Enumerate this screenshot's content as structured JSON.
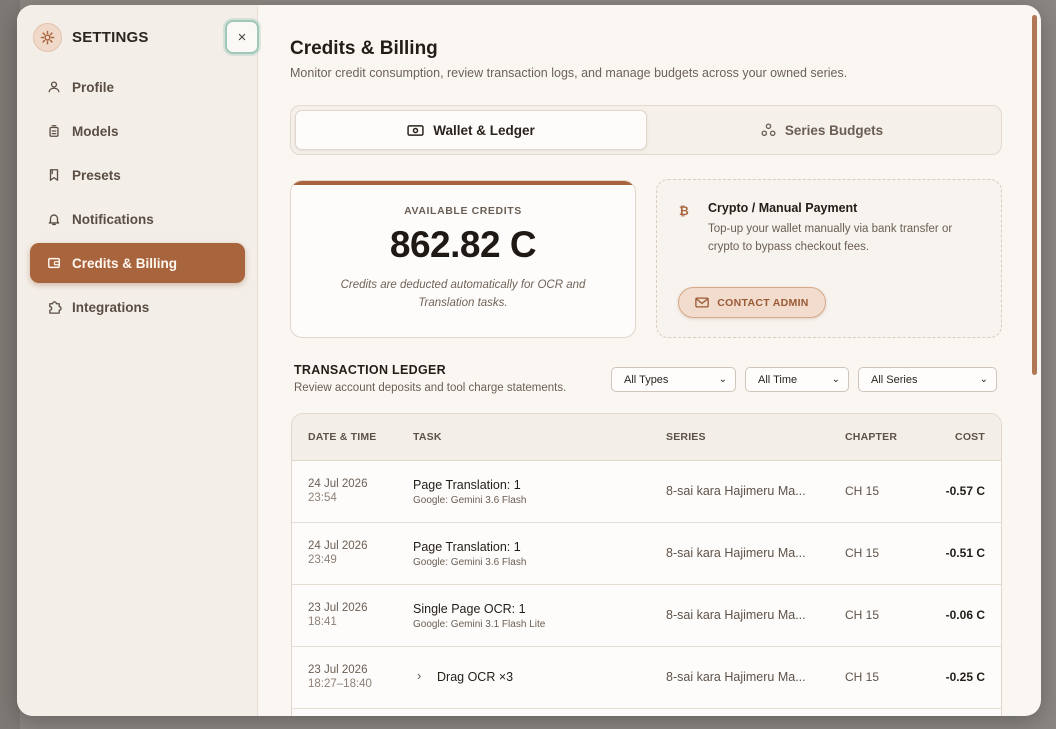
{
  "sidebar": {
    "title": "SETTINGS",
    "close_label": "×",
    "items": [
      {
        "label": "Profile",
        "icon": "user-icon"
      },
      {
        "label": "Models",
        "icon": "model-icon"
      },
      {
        "label": "Presets",
        "icon": "bookmark-icon"
      },
      {
        "label": "Notifications",
        "icon": "bell-icon"
      },
      {
        "label": "Credits & Billing",
        "icon": "wallet-icon",
        "active": true
      },
      {
        "label": "Integrations",
        "icon": "puzzle-icon"
      }
    ]
  },
  "main": {
    "title": "Credits & Billing",
    "subtitle": "Monitor credit consumption, review transaction logs, and manage budgets across your owned series.",
    "tabs": [
      {
        "label": "Wallet & Ledger",
        "active": true
      },
      {
        "label": "Series Budgets",
        "active": false
      }
    ],
    "credits": {
      "label": "AVAILABLE CREDITS",
      "value": "862.82 C",
      "note": "Credits are deducted automatically for OCR and Translation tasks."
    },
    "crypto": {
      "symbol": "₿",
      "title": "Crypto / Manual Payment",
      "description": "Top-up your wallet manually via bank transfer or crypto to bypass checkout fees.",
      "button": "CONTACT ADMIN"
    },
    "ledger": {
      "title": "TRANSACTION LEDGER",
      "subtitle": "Review account deposits and tool charge statements.",
      "filters": [
        "All Types",
        "All Time",
        "All Series"
      ],
      "columns": [
        "DATE & TIME",
        "TASK",
        "SERIES",
        "CHAPTER",
        "COST"
      ],
      "rows": [
        {
          "date": "24 Jul 2026",
          "time": "23:54",
          "task": "Page Translation: 1",
          "model": "Google: Gemini 3.6 Flash",
          "series": "8-sai kara Hajimeru Ma...",
          "chapter": "CH 15",
          "cost": "-0.57 C"
        },
        {
          "date": "24 Jul 2026",
          "time": "23:49",
          "task": "Page Translation: 1",
          "model": "Google: Gemini 3.6 Flash",
          "series": "8-sai kara Hajimeru Ma...",
          "chapter": "CH 15",
          "cost": "-0.51 C"
        },
        {
          "date": "23 Jul 2026",
          "time": "18:41",
          "task": "Single Page OCR: 1",
          "model": "Google: Gemini 3.1 Flash Lite",
          "series": "8-sai kara Hajimeru Ma...",
          "chapter": "CH 15",
          "cost": "-0.06 C"
        },
        {
          "date": "23 Jul 2026",
          "time": "18:27–18:40",
          "task": "Drag OCR ×3",
          "model": "",
          "series": "8-sai kara Hajimeru Ma...",
          "chapter": "CH 15",
          "cost": "-0.25 C",
          "expandable": true
        }
      ]
    }
  },
  "colors": {
    "accent": "#a8643c",
    "background": "#faf7f3",
    "sidebar": "#f3eee8"
  }
}
